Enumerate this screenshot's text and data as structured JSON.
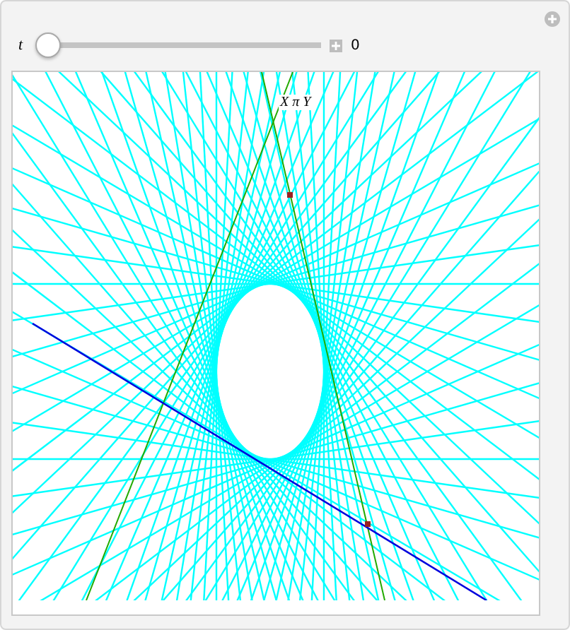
{
  "control": {
    "label": "t",
    "level": 0,
    "reading": "0"
  },
  "plot": {
    "label": "X π Y"
  }
}
